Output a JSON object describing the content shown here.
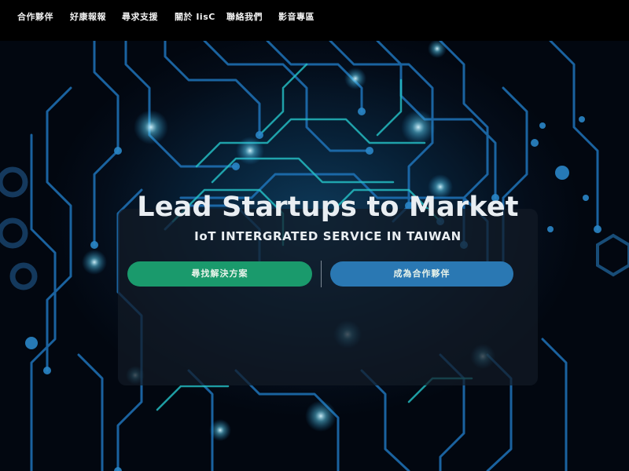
{
  "nav": {
    "items": [
      {
        "label": "合作夥伴"
      },
      {
        "label": "好康報報"
      },
      {
        "label": "尋求支援"
      },
      {
        "label": "關於 IisC"
      },
      {
        "label": "聯絡我們"
      },
      {
        "label": "影音專區"
      }
    ]
  },
  "hero": {
    "headline": "Lead Startups to Market",
    "subline": "IoT INTERGRATED SERVICE IN TAIWAN",
    "primary_button": "尋找解決方案",
    "secondary_button": "成為合作夥伴"
  },
  "colors": {
    "nav_background": "#000000",
    "primary_button": "#1a9a6c",
    "secondary_button": "#2a78b3",
    "circuit_glow": "#2bb3e0"
  }
}
